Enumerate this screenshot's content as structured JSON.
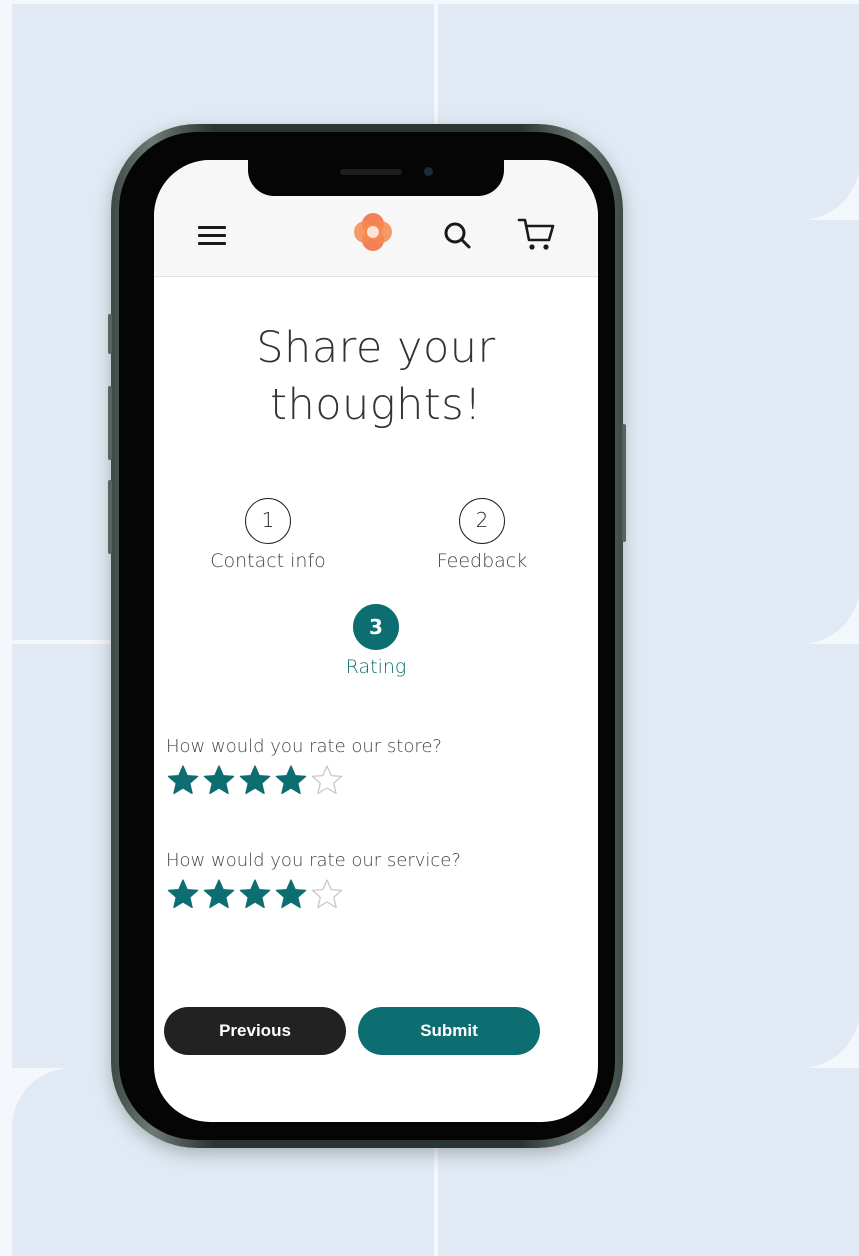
{
  "page": {
    "title": "Share your thoughts!"
  },
  "steps": [
    {
      "number": "1",
      "label": "Contact info",
      "active": false
    },
    {
      "number": "2",
      "label": "Feedback",
      "active": false
    },
    {
      "number": "3",
      "label": "Rating",
      "active": true
    }
  ],
  "ratings": [
    {
      "question": "How would you rate our store?",
      "value": 4,
      "max": 5
    },
    {
      "question": "How would you rate our service?",
      "value": 4,
      "max": 5
    }
  ],
  "buttons": {
    "previous_label": "Previous",
    "submit_label": "Submit"
  },
  "header": {
    "menu_icon": "hamburger-icon",
    "logo_icon": "brand-logo",
    "search_icon": "search-icon",
    "cart_icon": "cart-icon"
  },
  "colors": {
    "accent": "#0c6e71",
    "dark": "#222222",
    "logo": "#f26b3a"
  }
}
